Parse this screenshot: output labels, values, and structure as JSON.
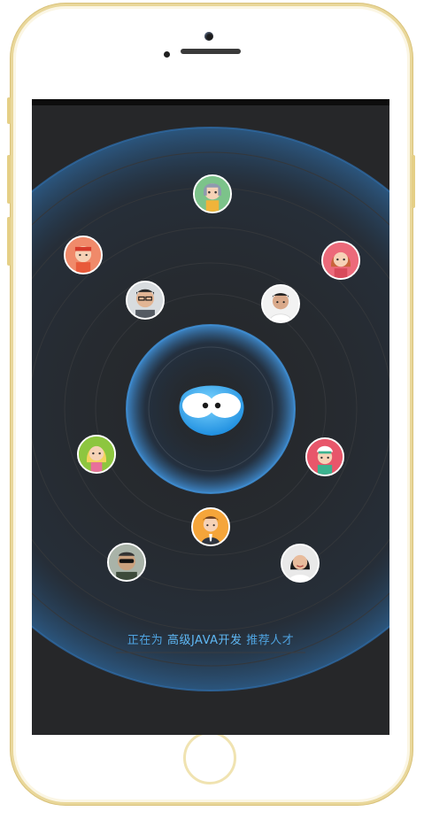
{
  "status": {
    "prefix": "正在为",
    "job": "高级JAVA开发",
    "suffix": "推荐人才"
  },
  "avatars": [
    {
      "name": "avatar-cartoon-girl-gray-hair",
      "bg": "#7cc38a"
    },
    {
      "name": "avatar-cartoon-boy-headband",
      "bg": "#f08a6a"
    },
    {
      "name": "avatar-cartoon-woman-red-hair",
      "bg": "#ec6a7a"
    },
    {
      "name": "avatar-photo-man-glasses",
      "bg": "#cfd3d6"
    },
    {
      "name": "avatar-photo-man-white-shirt",
      "bg": "#ececec"
    },
    {
      "name": "avatar-cartoon-blonde-woman",
      "bg": "#8dc63f"
    },
    {
      "name": "avatar-cartoon-nurse",
      "bg": "#e8566a"
    },
    {
      "name": "avatar-cartoon-businessman",
      "bg": "#f5a53a"
    },
    {
      "name": "avatar-photo-man-sunglasses",
      "bg": "#9aa6a0"
    },
    {
      "name": "avatar-photo-woman-smiling",
      "bg": "#e6e6e6"
    }
  ],
  "colors": {
    "screen_bg": "#262729",
    "ring": "#3c8fd6",
    "status_text": "#4fa3e0",
    "frame_gold": "#e9d79a"
  },
  "icons": {
    "center": "blue-blob-mascot-icon"
  }
}
